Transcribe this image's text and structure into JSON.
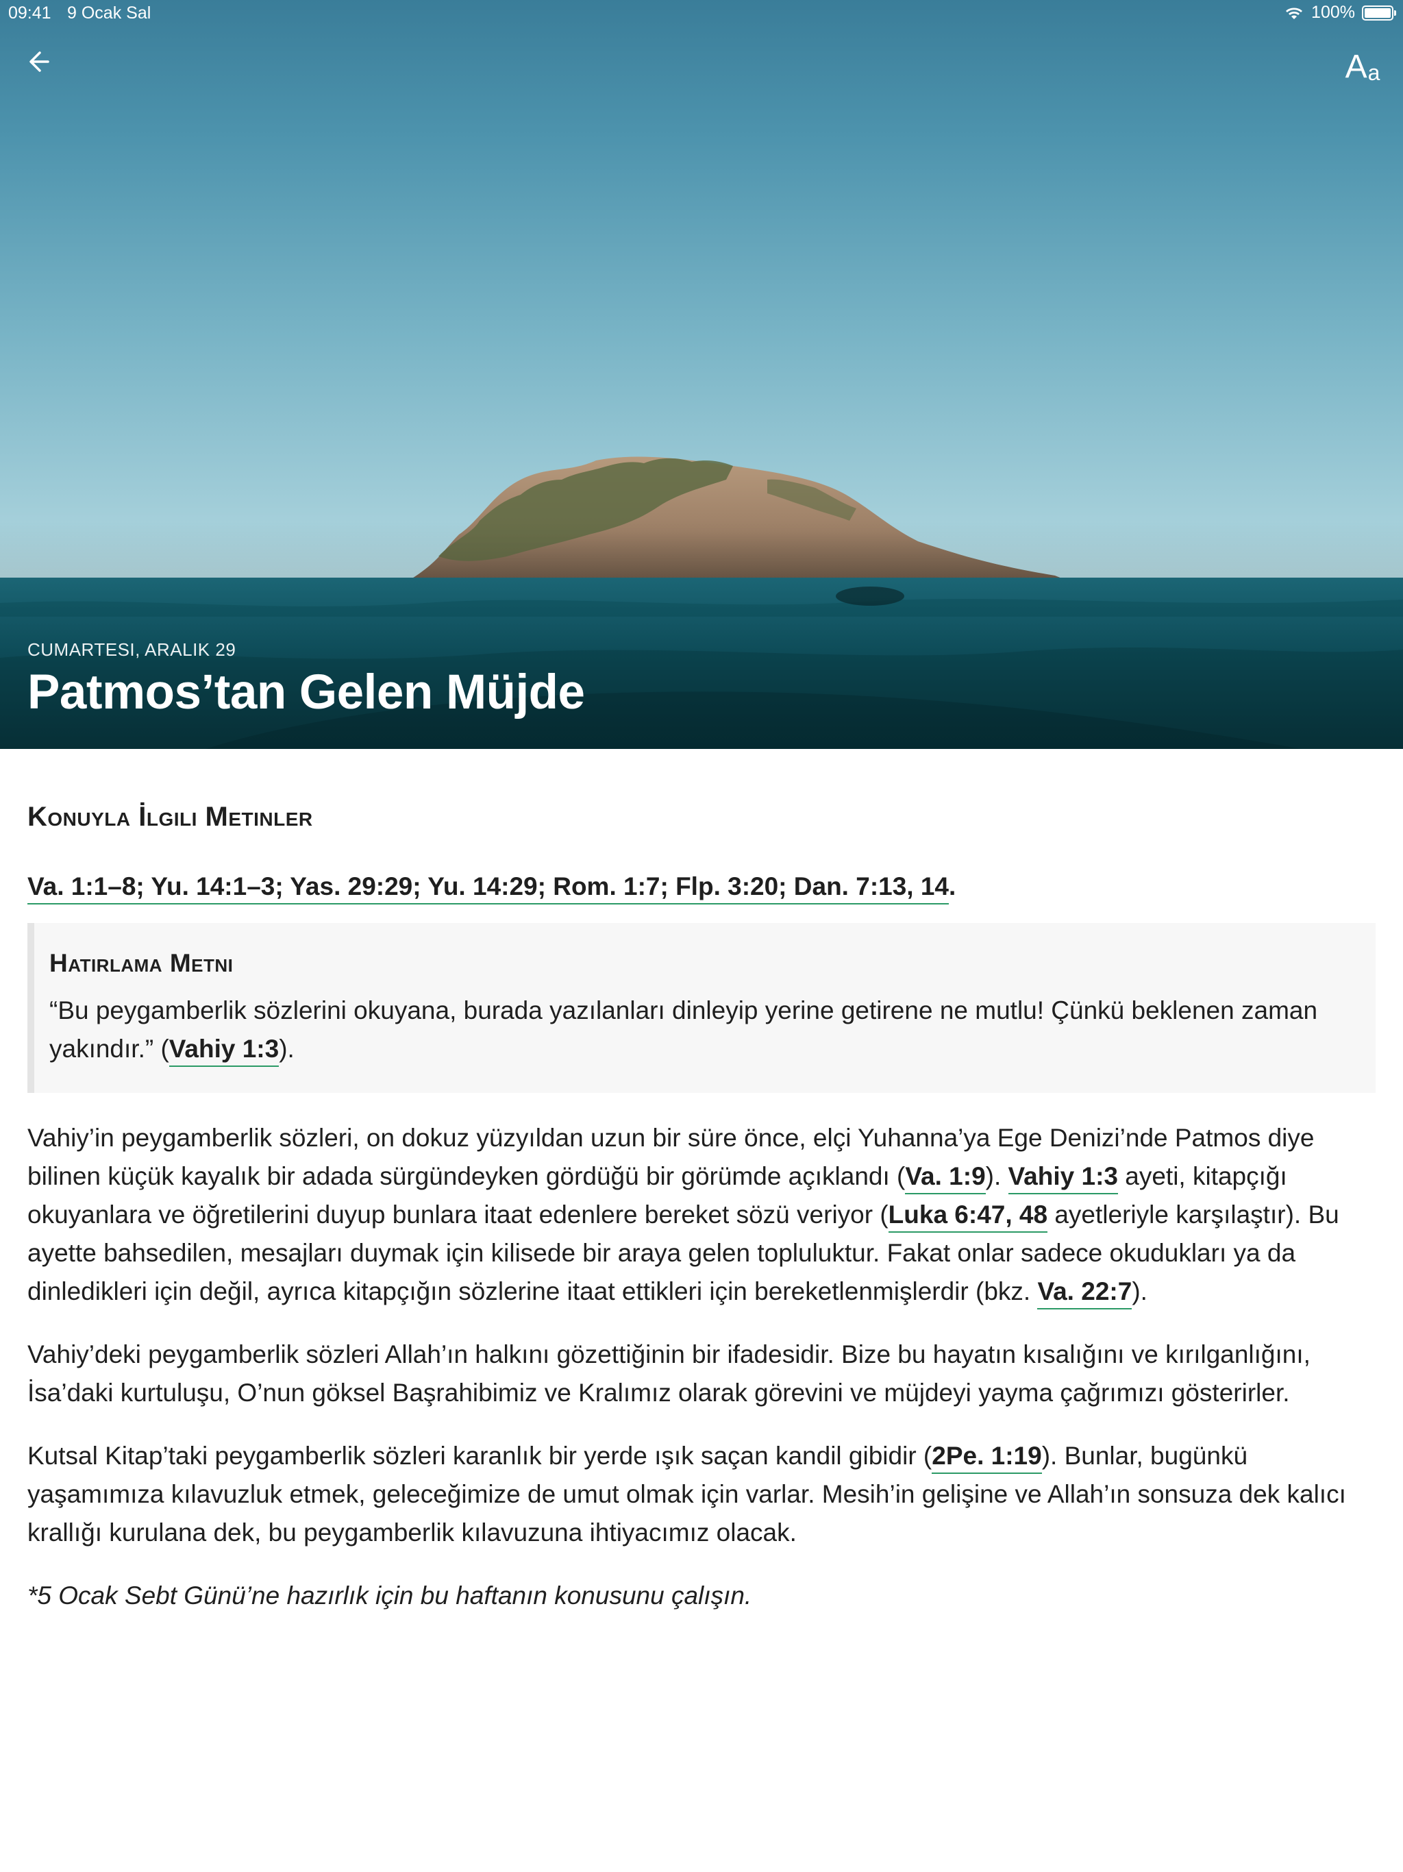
{
  "status_bar": {
    "time": "09:41",
    "date": "9 Ocak Sal",
    "battery": "100%"
  },
  "header": {
    "back_icon": "arrow-left-icon",
    "font_button_big": "A",
    "font_button_small": "a"
  },
  "hero": {
    "date": "CUMARTESI, ARALIK 29",
    "title": "Patmos’tan Gelen Müjde"
  },
  "related": {
    "heading": "Konuyla İlgili Metinler",
    "references": "Va. 1:1–8; Yu. 14:1–3; Yas. 29:29; Yu. 14:29; Rom. 1:7; Flp. 3:20; Dan. 7:13, 14",
    "end": "."
  },
  "memory": {
    "heading": "Hatırlama Metni",
    "text": "“Bu peygamberlik sözlerini okuyana, burada yazılanları dinleyip yerine getirene ne mutlu! Çünkü beklenen zaman yakındır.” (",
    "ref": "Vahiy 1:3",
    "end": ")."
  },
  "paragraphs": {
    "p1": {
      "t1": "Vahiy’in peygamberlik sözleri, on dokuz yüzyıldan uzun bir süre önce, elçi Yuhanna’ya Ege Denizi’nde Patmos diye bilinen küçük kayalık bir adada sürgündeyken gördüğü bir görümde açıklandı (",
      "r1": "Va. 1:9",
      "t2": "). ",
      "r2": "Vahiy 1:3",
      "t3": " ayeti, kitapçığı okuyanlara ve öğretilerini duyup bunlara itaat edenlere bereket sözü veriyor (",
      "r3": "Luka 6:47, 48",
      "t4": " ayetleriyle karşılaştır). Bu ayette bahsedilen, mesajları duymak için kilisede bir araya gelen topluluktur. Fakat onlar sadece okudukları ya da dinledikleri için değil, ayrıca kitapçığın sözlerine itaat ettikleri için bereketlenmişlerdir (bkz. ",
      "r4": "Va. 22:7",
      "t5": ")."
    },
    "p2": "Vahiy’deki peygamberlik sözleri Allah’ın halkını gözettiğinin bir ifadesidir. Bize bu hayatın kısalığını ve kırılganlığını, İsa’daki kurtuluşu, O’nun göksel Başrahibimiz ve Kralımız olarak görevini ve müjdeyi yayma çağrımızı gösterirler.",
    "p3": {
      "t1": "Kutsal Kitap’taki peygamberlik sözleri karanlık bir yerde ışık saçan kandil gibidir (",
      "r1": "2Pe. 1:19",
      "t2": "). Bunlar, bugünkü yaşamımıza kılavuzluk etmek, geleceğimize de umut olmak için varlar. Mesih’in gelişine ve Allah’ın sonsuza dek kalıcı krallığı kurulana dek, bu peygamberlik kılavuzuna ihtiyacımız olacak."
    },
    "note": "*5 Ocak Sebt Günü’ne hazırlık için bu haftanın konusunu çalışın."
  },
  "colors": {
    "link_underline": "#2b9a66",
    "memory_bg": "#f7f7f7",
    "memory_border": "#e4e4e4"
  }
}
